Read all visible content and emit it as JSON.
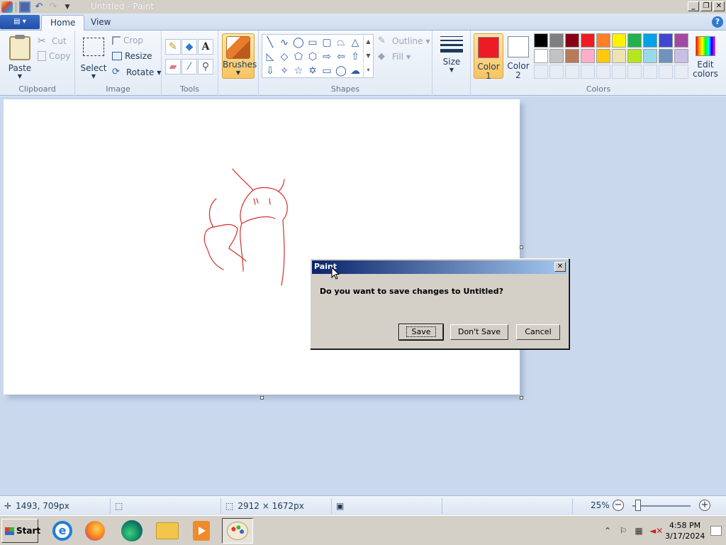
{
  "window": {
    "title": "Untitled - Paint"
  },
  "ribbon": {
    "tabs": [
      {
        "label": "Home"
      },
      {
        "label": "View"
      }
    ],
    "clipboard": {
      "label": "Clipboard",
      "paste": "Paste",
      "cut": "Cut",
      "copy": "Copy"
    },
    "image": {
      "label": "Image",
      "select": "Select",
      "crop": "Crop",
      "resize": "Resize",
      "rotate": "Rotate"
    },
    "tools": {
      "label": "Tools"
    },
    "brushes": {
      "label": "Brushes"
    },
    "shapes": {
      "label": "Shapes",
      "outline": "Outline",
      "fill": "Fill"
    },
    "size": {
      "label": "Size"
    },
    "color1": {
      "label": "Color",
      "num": "1",
      "value": "#ed1c24"
    },
    "color2": {
      "label": "Color",
      "num": "2",
      "value": "#ffffff"
    },
    "colors": {
      "label": "Colors",
      "edit_label": "Edit",
      "edit_label2": "colors",
      "palette_row1": [
        "#000000",
        "#7f7f7f",
        "#880015",
        "#ed1c24",
        "#ff7f27",
        "#fff200",
        "#22b14c",
        "#00a2e8",
        "#3f48cc",
        "#a349a4"
      ],
      "palette_row2": [
        "#ffffff",
        "#c3c3c3",
        "#b97a57",
        "#ffaec9",
        "#ffc90e",
        "#efe4b0",
        "#b5e61d",
        "#99d9ea",
        "#7092be",
        "#c8bfe7"
      ]
    }
  },
  "dialog": {
    "title": "Paint",
    "message": "Do you want to save changes to Untitled?",
    "save": "Save",
    "dont_save": "Don't Save",
    "cancel": "Cancel"
  },
  "statusbar": {
    "cursor_pos": "1493, 709px",
    "image_size": "2912 × 1672px",
    "zoom": "25%"
  },
  "taskbar": {
    "start": "Start",
    "time": "4:58 PM",
    "date": "3/17/2024"
  }
}
